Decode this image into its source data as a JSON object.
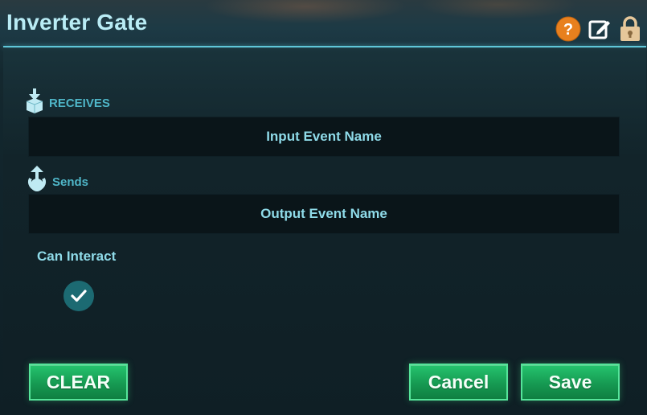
{
  "window": {
    "title": "Inverter Gate"
  },
  "header_icons": [
    {
      "name": "help-icon",
      "glyph": "?"
    },
    {
      "name": "edit-icon"
    },
    {
      "name": "lock-icon"
    }
  ],
  "receives": {
    "label": "RECEIVES",
    "icon": "receive-arrow-icon",
    "field_value": "Input Event Name"
  },
  "sends": {
    "label": "Sends",
    "icon": "send-arrow-icon",
    "field_value": "Output Event Name"
  },
  "can_interact": {
    "label": "Can Interact",
    "checked": true
  },
  "buttons": {
    "clear": "CLEAR",
    "cancel": "Cancel",
    "save": "Save"
  },
  "colors": {
    "title": "#b9ecf5",
    "accent": "#5fc6d8",
    "button_green": "#1fae5f",
    "help_orange": "#e8801e"
  }
}
